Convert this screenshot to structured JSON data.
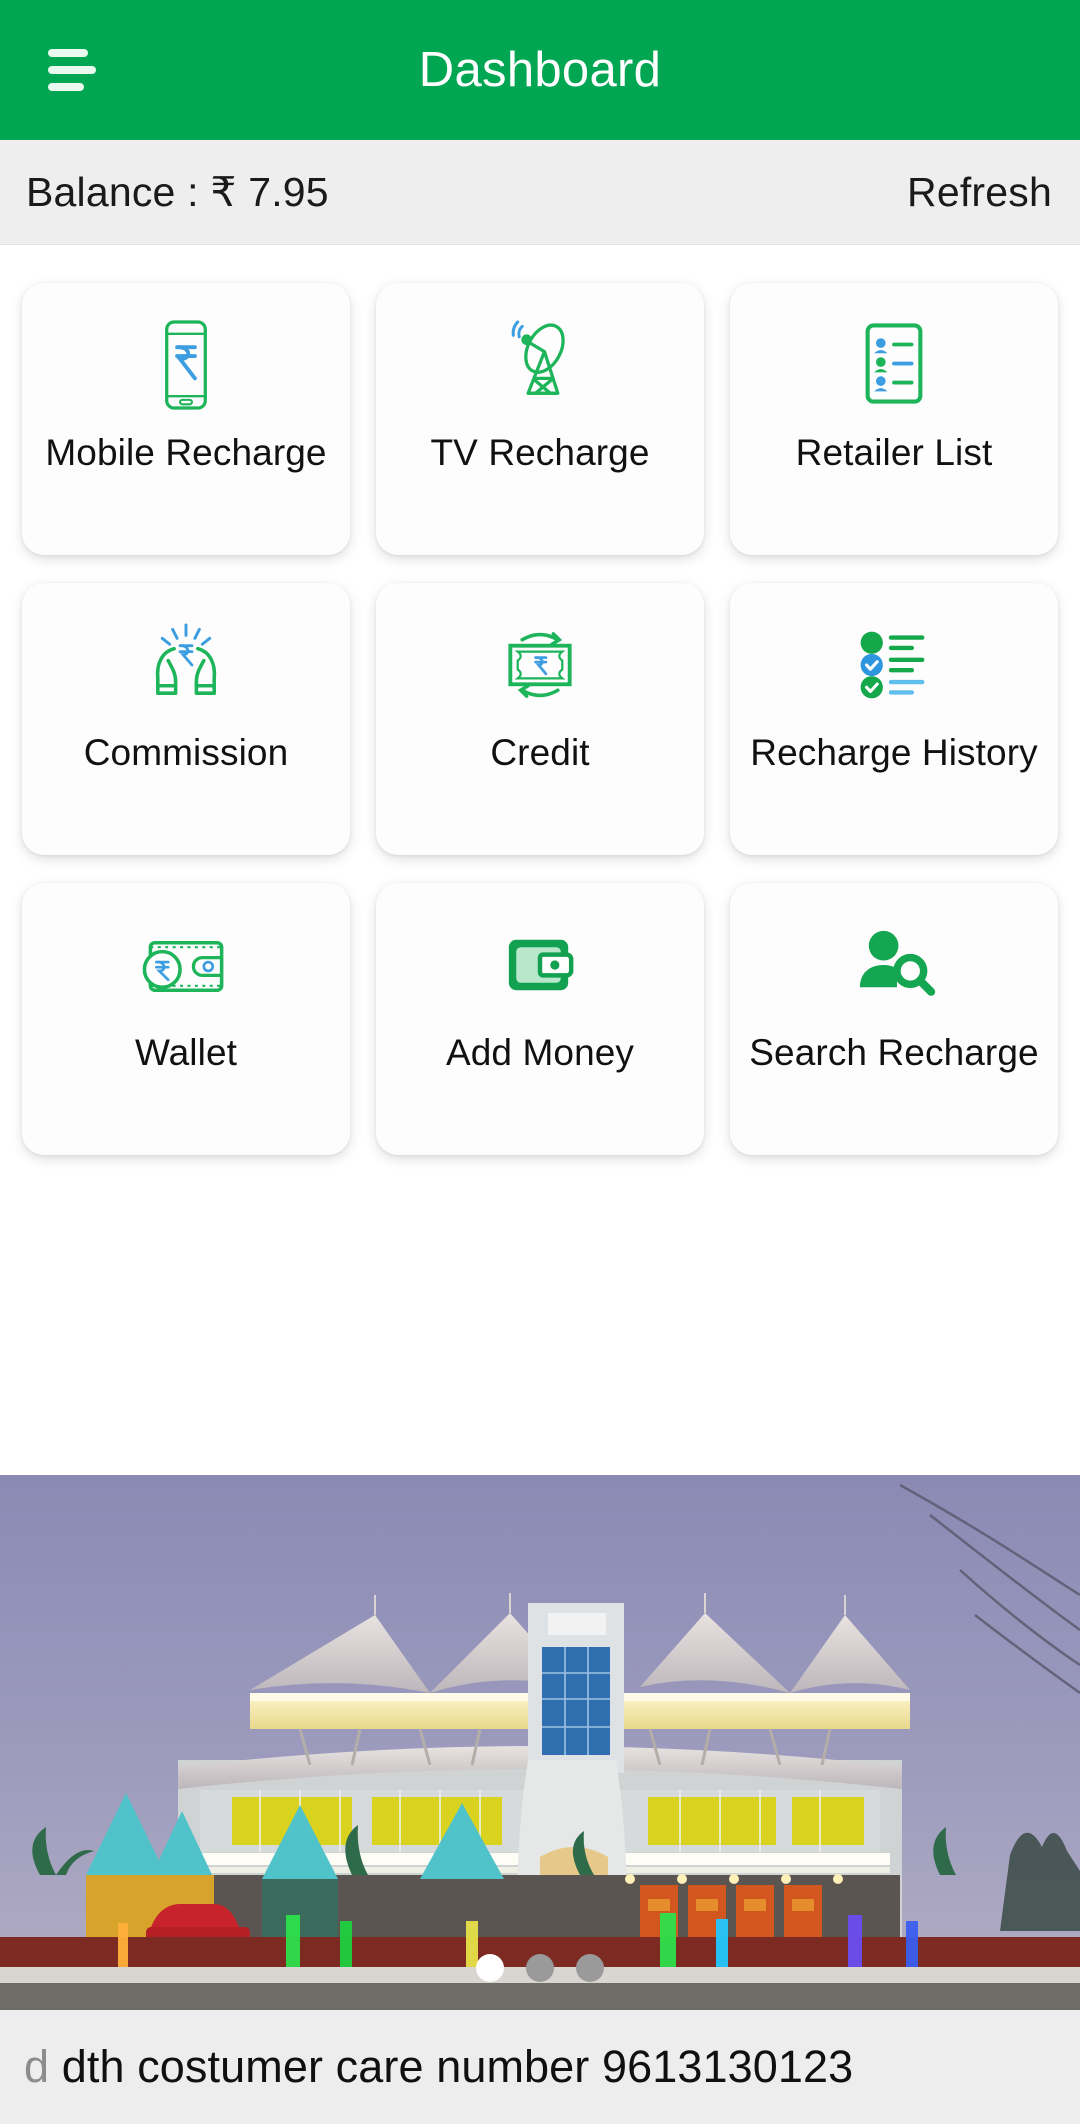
{
  "header": {
    "title": "Dashboard",
    "menu_icon": "hamburger-menu-icon",
    "background_color": "#00A651"
  },
  "balance_bar": {
    "balance_label": "Balance : ₹ 7.95",
    "refresh_label": "Refresh",
    "background_color": "#EEEEEE"
  },
  "grid": {
    "tiles": [
      {
        "label": "Mobile Recharge",
        "icon": "mobile-phone-rupee-icon"
      },
      {
        "label": "TV Recharge",
        "icon": "satellite-dish-icon"
      },
      {
        "label": "Retailer List",
        "icon": "clipboard-people-list-icon"
      },
      {
        "label": "Commission",
        "icon": "hands-holding-rupee-icon"
      },
      {
        "label": "Credit",
        "icon": "banknote-exchange-icon"
      },
      {
        "label": "Recharge History",
        "icon": "checklist-history-icon"
      },
      {
        "label": "Wallet",
        "icon": "wallet-rupee-coin-icon"
      },
      {
        "label": "Add Money",
        "icon": "filled-wallet-icon"
      },
      {
        "label": "Search Recharge",
        "icon": "person-search-icon"
      }
    ],
    "icon_green": "#1DB45A",
    "icon_blue": "#3C9EE0"
  },
  "banner": {
    "alt": "illuminated modern building at dusk",
    "dots": [
      {
        "active": true
      },
      {
        "active": false
      },
      {
        "active": false
      }
    ]
  },
  "ticker": {
    "clipped_prefix": "d",
    "text": " dth costumer care number 9613130123"
  }
}
